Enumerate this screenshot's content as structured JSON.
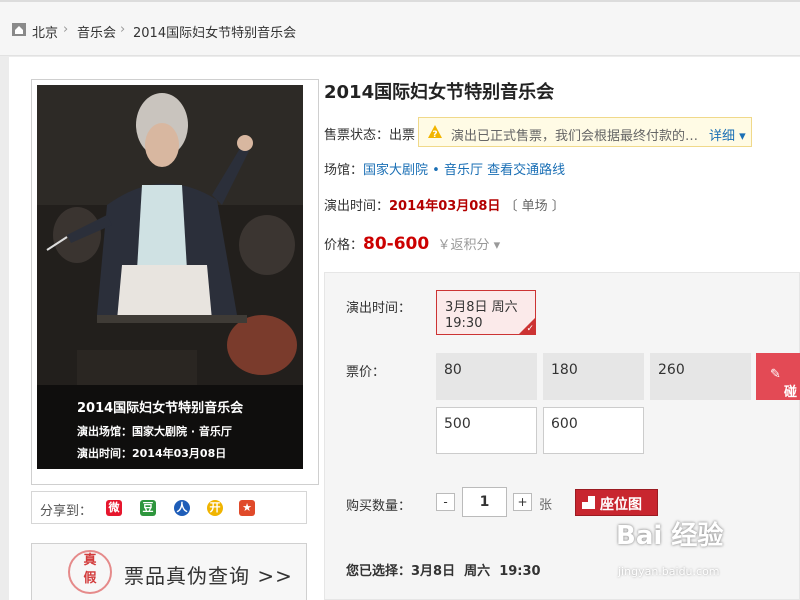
{
  "breadcrumb": {
    "home": "北京",
    "category": "音乐会",
    "current": "2014国际妇女节特别音乐会"
  },
  "poster": {
    "line1": "2014国际妇女节特别音乐会",
    "line2": "演出场馆：国家大剧院 · 音乐厅",
    "line3": "演出时间：2014年03月08日"
  },
  "share": {
    "label": "分享到："
  },
  "verify": {
    "seal_top": "真",
    "seal_bottom": "假",
    "text": "票品真伪查询 >>"
  },
  "event": {
    "title": "2014国际妇女节特别音乐会",
    "sale_status_label": "售票状态：",
    "sale_status_value": "出票",
    "notice_text": "演出已正式售票，我们会根据最终付款的…",
    "notice_more": "详细",
    "venue_label": "场馆：",
    "venue_value": "国家大剧院 • 音乐厅",
    "venue_link": "查看交通路线",
    "time_label": "演出时间：",
    "time_value": "2014年03月08日",
    "time_extra": "〔 单场 〕",
    "price_label": "价格：",
    "price_value": "80-600",
    "points_text": "￥返积分"
  },
  "ticket": {
    "time_label": "演出时间：",
    "session_line1": "3月8日 周六",
    "session_line2": "19:30",
    "price_label": "票价：",
    "prices": [
      "80",
      "180",
      "260",
      "500",
      "600"
    ],
    "cta_label": "碰",
    "qty_label": "购买数量：",
    "qty_minus": "-",
    "qty_value": "1",
    "qty_plus": "+",
    "qty_unit": "张",
    "seat_map": "座位图",
    "selected_label": "您已选择：",
    "selected_value": "3月8日  周六  19:30"
  },
  "watermark": {
    "main": "Bai 经验",
    "sub": "jingyan.baidu.com"
  }
}
